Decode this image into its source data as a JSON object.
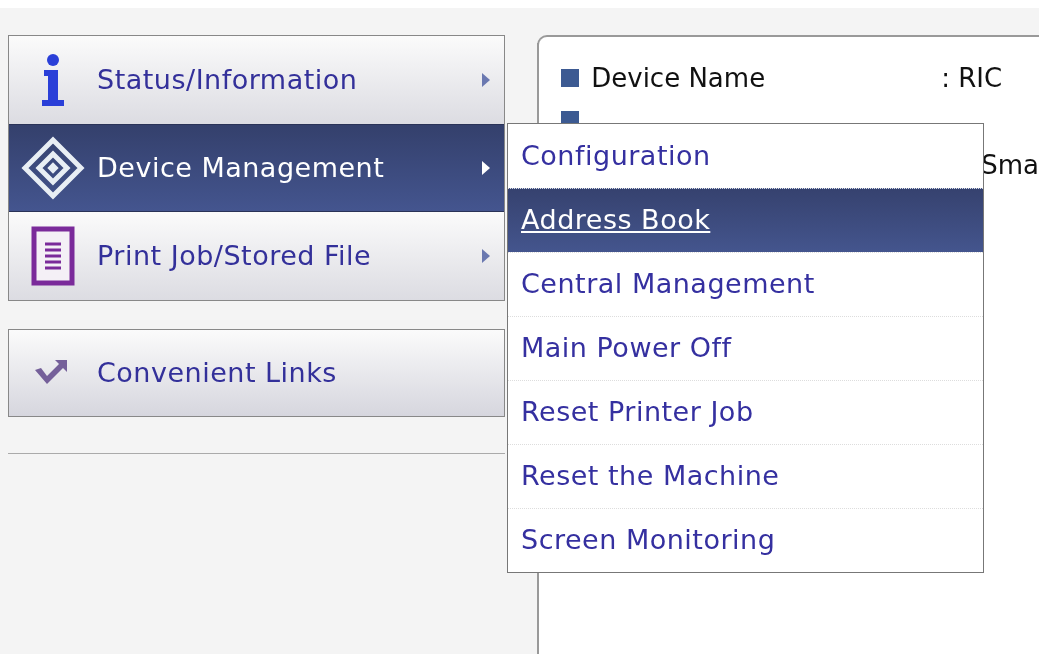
{
  "sidebar": {
    "menu": [
      {
        "label": "Status/Information",
        "kind": "info",
        "selected": false
      },
      {
        "label": "Device Management",
        "kind": "device",
        "selected": true
      },
      {
        "label": "Print Job/Stored File",
        "kind": "document",
        "selected": false
      }
    ],
    "links": {
      "label": "Convenient Links"
    }
  },
  "submenu": {
    "items": [
      {
        "label": "Configuration",
        "selected": false
      },
      {
        "label": "Address Book",
        "selected": true
      },
      {
        "label": "Central Management",
        "selected": false
      },
      {
        "label": "Main Power Off",
        "selected": false
      },
      {
        "label": "Reset Printer Job",
        "selected": false
      },
      {
        "label": "Reset the Machine",
        "selected": false
      },
      {
        "label": "Screen Monitoring",
        "selected": false
      }
    ]
  },
  "details": {
    "device_name_label": "Device Name",
    "device_name_value": ": RIC",
    "row_3_value": "Sma"
  }
}
